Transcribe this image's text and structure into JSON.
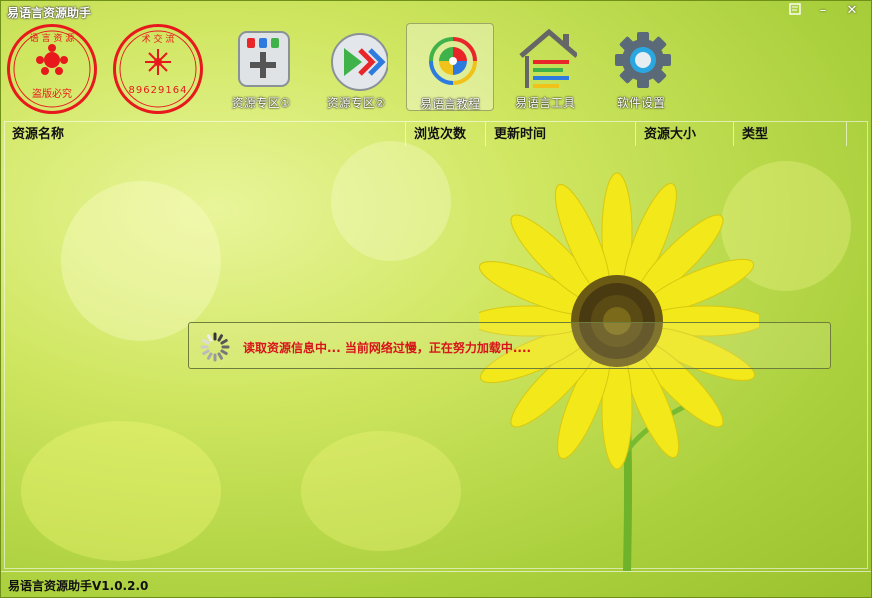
{
  "window": {
    "title": "易语言资源助手"
  },
  "toolbar": {
    "stamps": [
      {
        "name": "stamp-copyright",
        "bottom_text": "盗版必究"
      },
      {
        "name": "stamp-tech",
        "bottom_text": "89629164"
      }
    ],
    "buttons": [
      {
        "label": "资源专区①",
        "icon": "plus-tiles-icon"
      },
      {
        "label": "资源专区②",
        "icon": "play-arrows-icon"
      },
      {
        "label": "易语言教程",
        "icon": "signal-pie-icon"
      },
      {
        "label": "易语言工具",
        "icon": "house-icon"
      },
      {
        "label": "软件设置",
        "icon": "gear-icon"
      }
    ],
    "active_index": 2
  },
  "list": {
    "columns": [
      "资源名称",
      "浏览次数",
      "更新时间",
      "资源大小",
      "类型"
    ]
  },
  "loading": {
    "message": "读取资源信息中... 当前网络过慢，正在努力加载中...."
  },
  "status": {
    "text": "易语言资源助手V1.0.2.0"
  },
  "colors": {
    "stamp_red": "#e8191c",
    "loading_text": "#d8131a",
    "flower_petal": "#f2e81a",
    "flower_center": "#4a3a12"
  }
}
